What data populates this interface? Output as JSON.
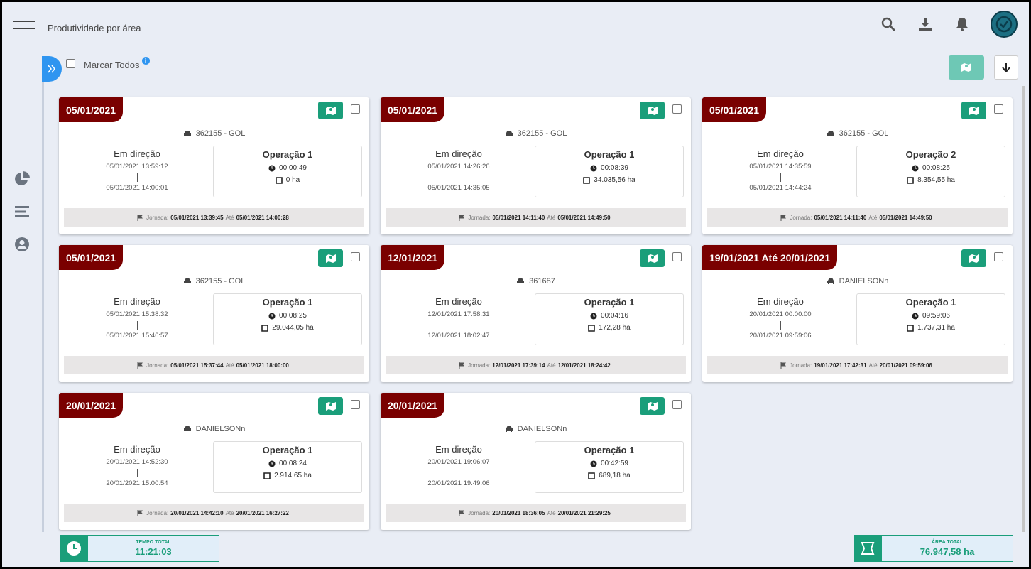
{
  "header": {
    "page_title": "Produtividade por área"
  },
  "toolbar": {
    "mark_all_label": "Marcar Todos",
    "info_icon_text": "i"
  },
  "colors": {
    "date_badge": "#7a0000",
    "accent_green": "#1a9e7a",
    "expand_blue": "#2f95f0"
  },
  "icons": [
    "menu-icon",
    "search-icon",
    "download-icon",
    "bell-icon",
    "pie-chart-icon",
    "list-icon",
    "user-icon",
    "map-icon",
    "car-icon",
    "clock-icon",
    "area-icon",
    "flag-icon",
    "arrow-down-icon"
  ],
  "cards": [
    {
      "date": "05/01/2021",
      "vehicle": "362155 - GOL",
      "status": "Em direção",
      "start": "05/01/2021 13:59:12",
      "end": "05/01/2021 14:00:01",
      "operation": "Operação 1",
      "duration": "00:00:49",
      "area": "0 ha",
      "footer_label": "Jornada:",
      "footer_start": "05/01/2021 13:39:45",
      "footer_until": "Até",
      "footer_end": "05/01/2021 14:00:28"
    },
    {
      "date": "05/01/2021",
      "vehicle": "362155 - GOL",
      "status": "Em direção",
      "start": "05/01/2021 14:26:26",
      "end": "05/01/2021 14:35:05",
      "operation": "Operação 1",
      "duration": "00:08:39",
      "area": "34.035,56 ha",
      "footer_label": "Jornada:",
      "footer_start": "05/01/2021 14:11:40",
      "footer_until": "Até",
      "footer_end": "05/01/2021 14:49:50"
    },
    {
      "date": "05/01/2021",
      "vehicle": "362155 - GOL",
      "status": "Em direção",
      "start": "05/01/2021 14:35:59",
      "end": "05/01/2021 14:44:24",
      "operation": "Operação 2",
      "duration": "00:08:25",
      "area": "8.354,55 ha",
      "footer_label": "Jornada:",
      "footer_start": "05/01/2021 14:11:40",
      "footer_until": "Até",
      "footer_end": "05/01/2021 14:49:50"
    },
    {
      "date": "05/01/2021",
      "vehicle": "362155 - GOL",
      "status": "Em direção",
      "start": "05/01/2021 15:38:32",
      "end": "05/01/2021 15:46:57",
      "operation": "Operação 1",
      "duration": "00:08:25",
      "area": "29.044,05 ha",
      "footer_label": "Jornada:",
      "footer_start": "05/01/2021 15:37:44",
      "footer_until": "Até",
      "footer_end": "05/01/2021 18:00:00"
    },
    {
      "date": "12/01/2021",
      "vehicle": "361687",
      "status": "Em direção",
      "start": "12/01/2021 17:58:31",
      "end": "12/01/2021 18:02:47",
      "operation": "Operação 1",
      "duration": "00:04:16",
      "area": "172,28 ha",
      "footer_label": "Jornada:",
      "footer_start": "12/01/2021 17:39:14",
      "footer_until": "Até",
      "footer_end": "12/01/2021 18:24:42"
    },
    {
      "date": "19/01/2021 Até 20/01/2021",
      "vehicle": "DANIELSONn",
      "status": "Em direção",
      "start": "20/01/2021 00:00:00",
      "end": "20/01/2021 09:59:06",
      "operation": "Operação 1",
      "duration": "09:59:06",
      "area": "1.737,31 ha",
      "footer_label": "Jornada:",
      "footer_start": "19/01/2021 17:42:31",
      "footer_until": "Até",
      "footer_end": "20/01/2021 09:59:06"
    },
    {
      "date": "20/01/2021",
      "vehicle": "DANIELSONn",
      "status": "Em direção",
      "start": "20/01/2021 14:52:30",
      "end": "20/01/2021 15:00:54",
      "operation": "Operação 1",
      "duration": "00:08:24",
      "area": "2.914,65 ha",
      "footer_label": "Jornada:",
      "footer_start": "20/01/2021 14:42:10",
      "footer_until": "Até",
      "footer_end": "20/01/2021 16:27:22"
    },
    {
      "date": "20/01/2021",
      "vehicle": "DANIELSONn",
      "status": "Em direção",
      "start": "20/01/2021 19:06:07",
      "end": "20/01/2021 19:49:06",
      "operation": "Operação 1",
      "duration": "00:42:59",
      "area": "689,18 ha",
      "footer_label": "Jornada:",
      "footer_start": "20/01/2021 18:36:05",
      "footer_until": "Até",
      "footer_end": "20/01/2021 21:29:25"
    }
  ],
  "totals": {
    "time_label": "TEMPO TOTAL",
    "time_value": "11:21:03",
    "area_label": "ÁREA TOTAL",
    "area_value": "76.947,58 ha"
  }
}
